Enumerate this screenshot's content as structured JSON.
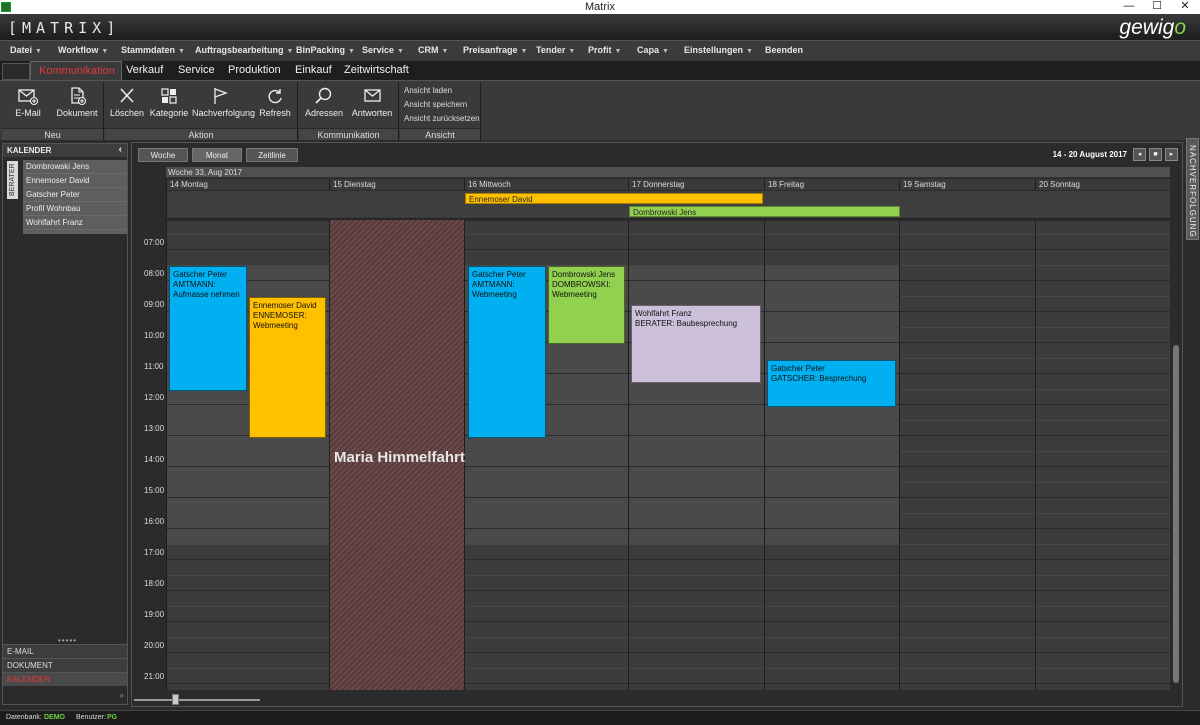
{
  "window": {
    "title": "Matrix",
    "minimize": "—",
    "maximize": "☐",
    "close": "✕"
  },
  "brand": {
    "left": "[MATRIX]",
    "right_pre": "gew",
    "right_i": "i",
    "right_post": "g",
    "right_o": "o"
  },
  "menu": [
    {
      "label": "Datei",
      "caret": true
    },
    {
      "label": "Workflow",
      "caret": true
    },
    {
      "label": "Stammdaten",
      "caret": true
    },
    {
      "label": "Auftragsbearbeitung",
      "caret": true
    },
    {
      "label": "BinPacking",
      "caret": true
    },
    {
      "label": "Service",
      "caret": true
    },
    {
      "label": "CRM",
      "caret": true
    },
    {
      "label": "Preisanfrage",
      "caret": true
    },
    {
      "label": "Tender",
      "caret": true
    },
    {
      "label": "Profit",
      "caret": true
    },
    {
      "label": "Capa",
      "caret": true
    },
    {
      "label": "Einstellungen",
      "caret": true
    },
    {
      "label": "Beenden",
      "caret": false
    }
  ],
  "ribbon_tabs": [
    "Kommunikation",
    "Verkauf",
    "Service",
    "Produktion",
    "Einkauf",
    "Zeitwirtschaft"
  ],
  "ribbon": {
    "groups": {
      "neu": "Neu",
      "aktion": "Aktion",
      "kommunikation": "Kommunikation",
      "ansicht": "Ansicht"
    },
    "buttons": {
      "email": "E-Mail",
      "dokument": "Dokument",
      "loeschen": "Löschen",
      "kategorie": "Kategorie",
      "nachverfolgung": "Nachverfolgung",
      "refresh": "Refresh",
      "adressen": "Adressen",
      "antworten": "Antworten"
    },
    "ansicht_items": [
      "Ansicht laden",
      "Ansicht speichern",
      "Ansicht zurücksetzen"
    ]
  },
  "left_panel": {
    "header": "KALENDER",
    "collapse": "‹",
    "side_tab": "BERATER",
    "people": [
      "Dombrowski Jens",
      "Ennemoser David",
      "Gatscher Peter",
      "Profil Wohnbau",
      "Wohlfahrt Franz"
    ],
    "grip": "•••••",
    "nav": [
      "E-MAIL",
      "DOKUMENT",
      "KALENDER"
    ],
    "bottom_chevron": "»"
  },
  "right_strip": "NACHVERFOLGUNG",
  "calendar": {
    "views": [
      "Woche",
      "Monat",
      "Zeitlinie"
    ],
    "date_range": "14  - 20 August 2017",
    "nav": {
      "prev": "◂",
      "today": "■",
      "next": "▸"
    },
    "week_header": "Woche 33, Aug 2017",
    "days": [
      "14 Montag",
      "15 Dienstag",
      "16 Mittwoch",
      "17 Donnerstag",
      "18 Freitag",
      "19 Samstag",
      "20 Sonntag"
    ],
    "hours": [
      "07:00",
      "08:00",
      "09:00",
      "10:00",
      "11:00",
      "12:00",
      "13:00",
      "14:00",
      "15:00",
      "16:00",
      "17:00",
      "18:00",
      "19:00",
      "20:00",
      "21:00"
    ],
    "holiday": "Maria Himmelfahrt",
    "allday_events": [
      {
        "label": "Ennemoser David",
        "color": "#ffc000"
      },
      {
        "label": "Dombrowski Jens",
        "color": "#92d050"
      }
    ],
    "appointments": [
      {
        "lines": [
          "Gatscher Peter",
          "AMTMANN:",
          "Aufmasse nehmen"
        ],
        "color": "#00b0f0"
      },
      {
        "lines": [
          "Ennemoser David",
          "ENNEMOSER:",
          "Webmeeting"
        ],
        "color": "#ffc000"
      },
      {
        "lines": [
          "Gatscher Peter",
          "AMTMANN:",
          "Webmeeting"
        ],
        "color": "#00b0f0"
      },
      {
        "lines": [
          "Dombrowski Jens",
          "DOMBROWSKI:",
          "Webmeeting"
        ],
        "color": "#92d050"
      },
      {
        "lines": [
          "Wohlfahrt Franz",
          "BERATER: Baubesprechung"
        ],
        "color": "#ccc0da"
      },
      {
        "lines": [
          "Gatscher Peter",
          "GATSCHER: Besprechung"
        ],
        "color": "#00b0f0"
      }
    ]
  },
  "status": {
    "db_label": "Datenbank:",
    "db_value": "DEMO",
    "user_label": "Benutzer:",
    "user_value": "PG"
  }
}
